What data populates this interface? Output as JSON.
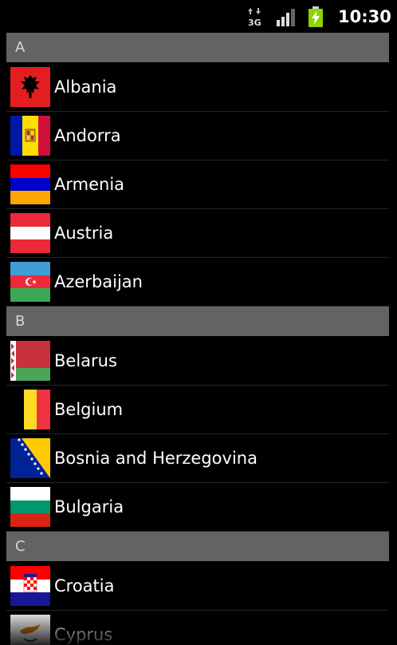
{
  "status_bar": {
    "time": "10:30",
    "network": "3G",
    "icons": [
      "3g-data-icon",
      "signal-icon",
      "battery-charging-icon"
    ]
  },
  "sections": [
    {
      "letter": "A",
      "countries": [
        {
          "name": "Albania",
          "flag_icon": "albania-flag-icon"
        },
        {
          "name": "Andorra",
          "flag_icon": "andorra-flag-icon"
        },
        {
          "name": "Armenia",
          "flag_icon": "armenia-flag-icon"
        },
        {
          "name": "Austria",
          "flag_icon": "austria-flag-icon"
        },
        {
          "name": "Azerbaijan",
          "flag_icon": "azerbaijan-flag-icon"
        }
      ]
    },
    {
      "letter": "B",
      "countries": [
        {
          "name": "Belarus",
          "flag_icon": "belarus-flag-icon"
        },
        {
          "name": "Belgium",
          "flag_icon": "belgium-flag-icon"
        },
        {
          "name": "Bosnia and Herzegovina",
          "flag_icon": "bosnia-flag-icon"
        },
        {
          "name": "Bulgaria",
          "flag_icon": "bulgaria-flag-icon"
        }
      ]
    },
    {
      "letter": "C",
      "countries": [
        {
          "name": "Croatia",
          "flag_icon": "croatia-flag-icon"
        },
        {
          "name": "Cyprus",
          "flag_icon": "cyprus-flag-icon"
        }
      ]
    }
  ],
  "colors": {
    "background": "#000000",
    "section_header": "#636363",
    "section_text": "#d6d6d6",
    "divider": "#262626",
    "row_text": "#ffffff",
    "battery_accent": "#8fd400"
  }
}
